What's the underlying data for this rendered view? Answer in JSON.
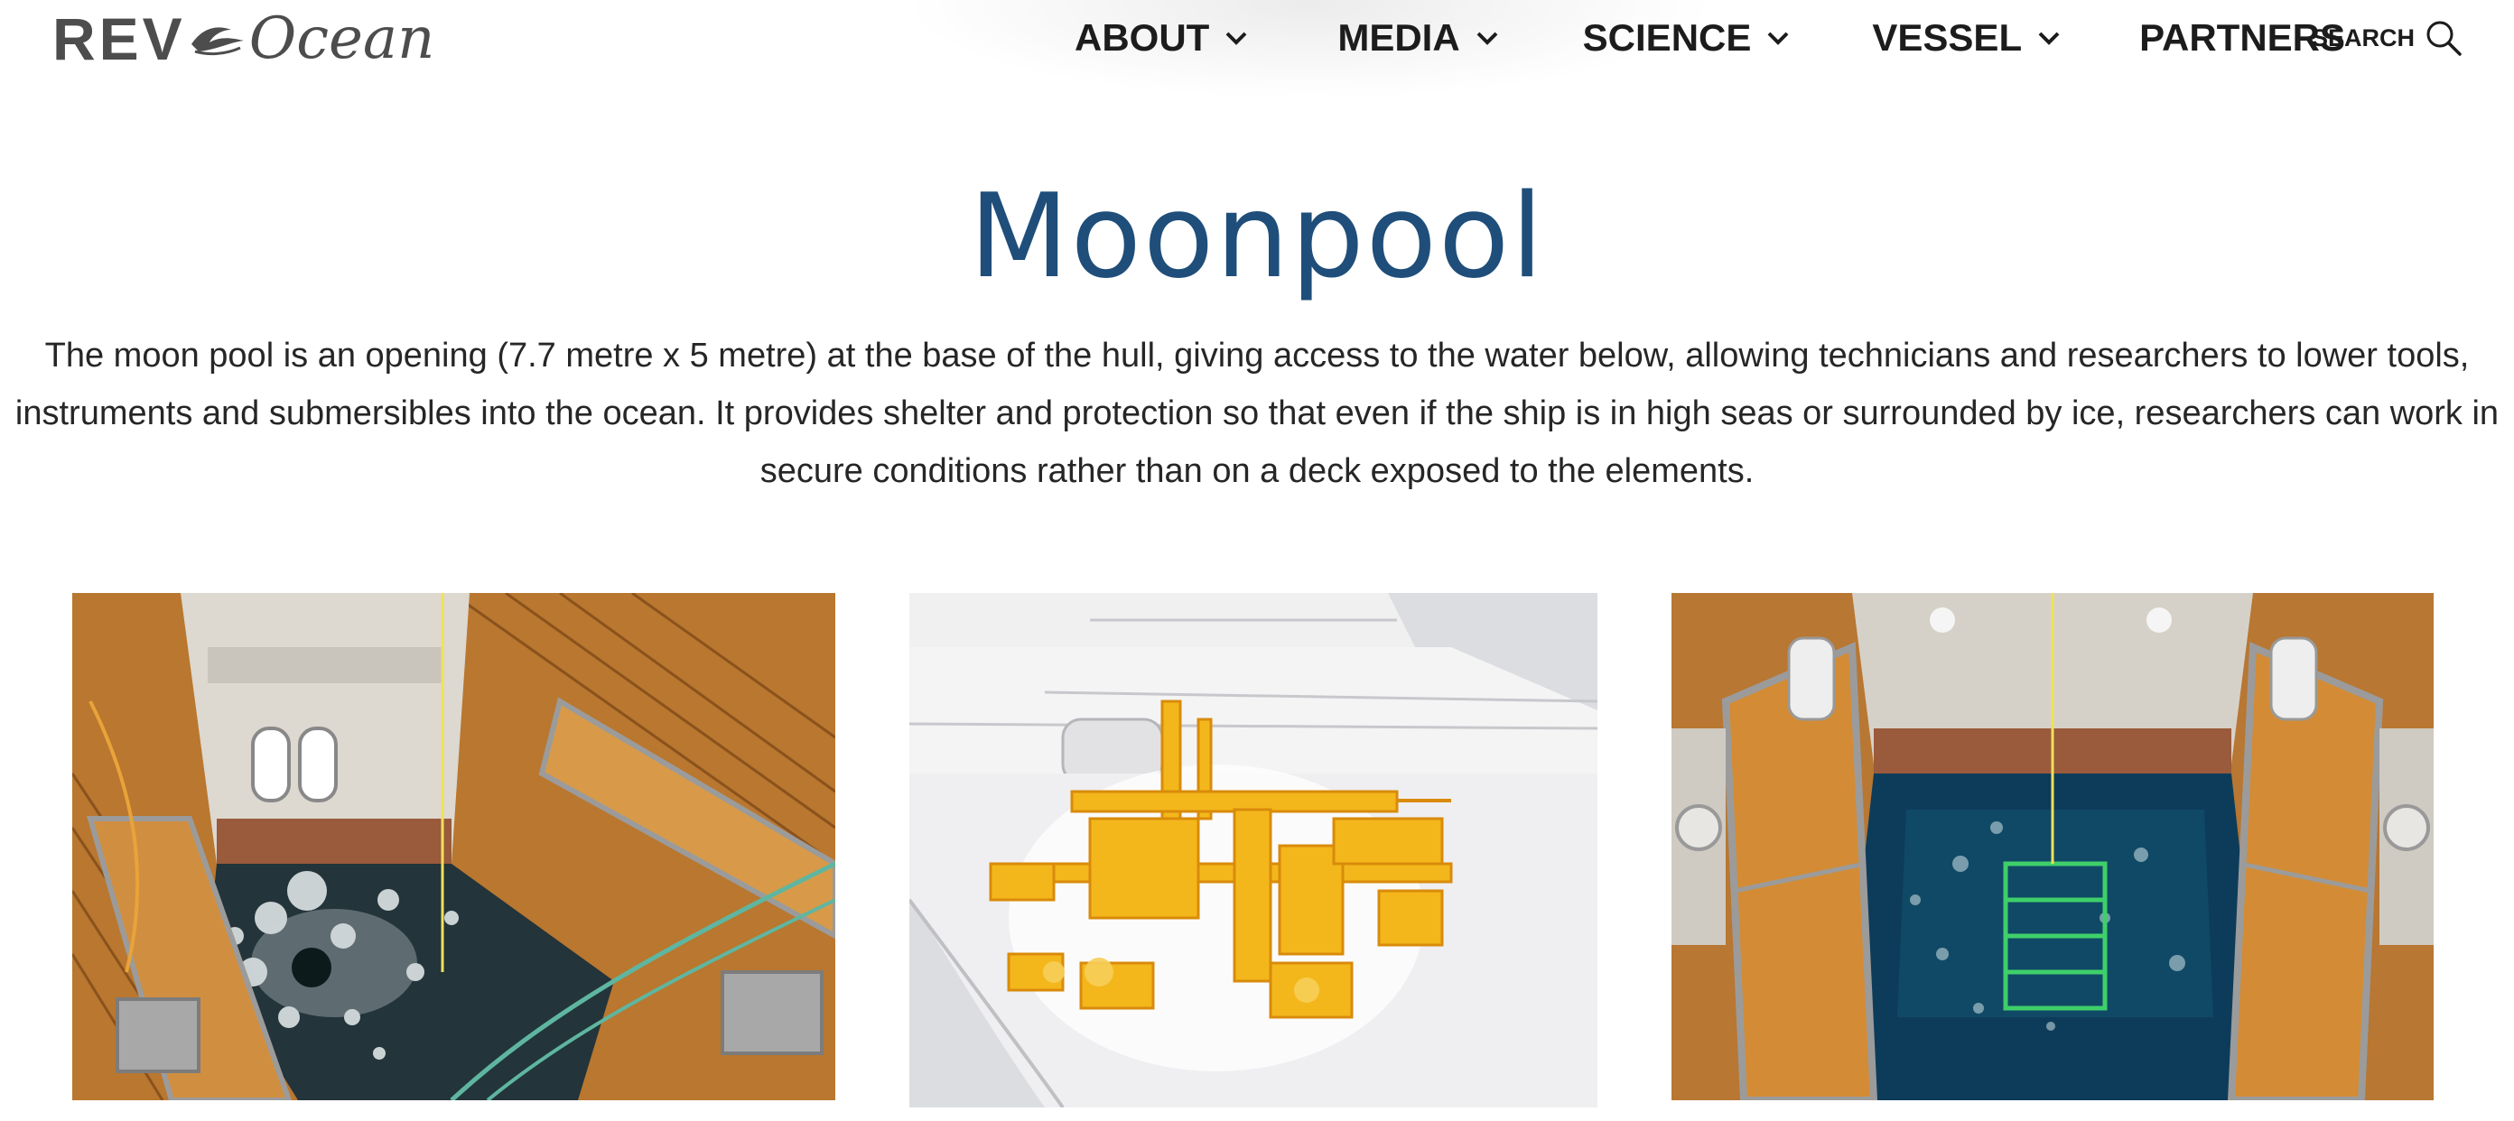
{
  "logo": {
    "left": "REV",
    "right": "Ocean"
  },
  "nav": {
    "items": [
      {
        "label": "ABOUT",
        "has_menu": true
      },
      {
        "label": "MEDIA",
        "has_menu": true
      },
      {
        "label": "SCIENCE",
        "has_menu": true
      },
      {
        "label": "VESSEL",
        "has_menu": true
      },
      {
        "label": "PARTNERS",
        "has_menu": false
      }
    ],
    "search_label": "SEARCH"
  },
  "page": {
    "title": "Moonpool",
    "intro_lines": [
      "The moon pool is an opening  (7.7 metre x 5 metre) at the base of the hull, giving access to the water below, allowing technicians and researchers to lower tools,",
      "instruments and submersibles into the ocean. It provides shelter and protection so that even if the ship is in high seas or surrounded by ice, researchers can work in",
      "secure conditions rather than on a deck exposed to the elements."
    ]
  },
  "gallery": [
    {
      "subject": "moonpool-ice-photo"
    },
    {
      "subject": "moonpool-3d-render"
    },
    {
      "subject": "moonpool-open-water-photo"
    }
  ],
  "colors": {
    "title": "#1f4e7a",
    "text": "#262626",
    "deck_wood": "#c88a3c",
    "water_ice": "#23343a",
    "render_yellow": "#f3b71c",
    "water_blue": "#0d3c5a"
  }
}
